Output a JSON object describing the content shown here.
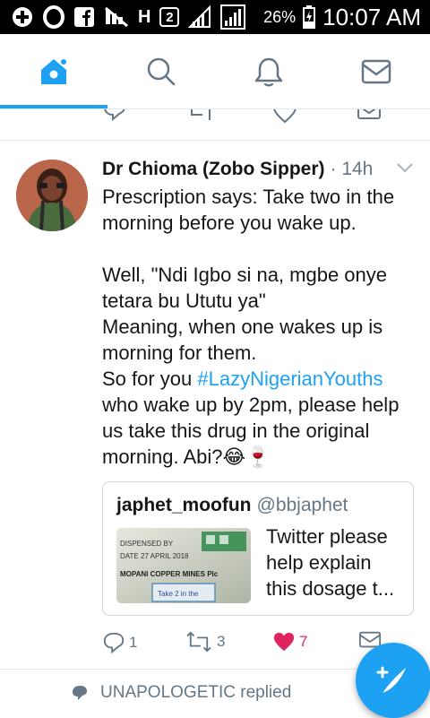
{
  "status_bar": {
    "signal_labels": [
      "H",
      "2"
    ],
    "battery": "26%",
    "time": "10:07 AM"
  },
  "nav": {
    "active_tab": "home",
    "accent": "#1da1f2",
    "tabs": [
      {
        "icon": "home-icon"
      },
      {
        "icon": "search-icon"
      },
      {
        "icon": "notifications-icon"
      },
      {
        "icon": "messages-icon"
      }
    ]
  },
  "tweet": {
    "author": "Dr Chioma (Zobo Sipper)",
    "meta": "· 14h",
    "text_lines": [
      "Prescription says: Take two in the",
      "morning before you wake up.",
      "",
      "Well, \"Ndi Igbo si na, mgbe onye",
      "tetara bu Ututu ya\"",
      "Meaning, when one wakes up is",
      "morning for them.",
      "So for you ",
      "who wake up by 2pm, please help",
      "us take this drug in the original",
      "morning. Abi?😂🍷"
    ],
    "hashtag": "#LazyNigerianYouths",
    "quote": {
      "name": "japhet_moofun",
      "handle": "@bbjaphet",
      "text_lines": [
        "Twitter please",
        "help explain",
        "this dosage t..."
      ],
      "image_text": [
        "DISPENSED BY",
        "DATE 27 APRIL 2018",
        "MOPANI COPPER MINES Plc",
        "Take 2 in the"
      ]
    },
    "actions": {
      "replies": "1",
      "retweets": "3",
      "likes": "7",
      "liked": true,
      "like_color": "#e0245e"
    }
  },
  "notice": {
    "text": "UNAPOLOGETIC replied"
  },
  "fab": {
    "icon": "compose-tweet-icon"
  }
}
